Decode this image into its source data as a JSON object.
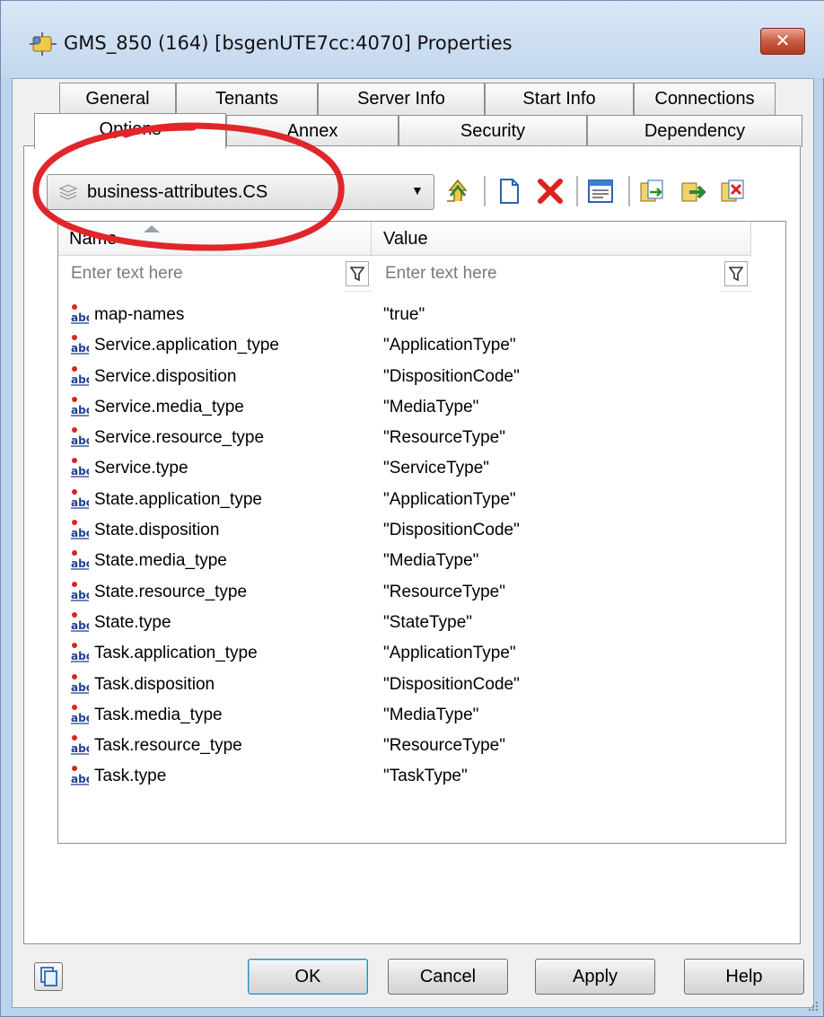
{
  "window": {
    "title": "GMS_850 (164) [bsgenUTE7cc:4070] Properties",
    "close_label": "✕"
  },
  "tabs_back": [
    "General",
    "Tenants",
    "Server Info",
    "Start Info",
    "Connections"
  ],
  "tabs_front": [
    "Options",
    "Annex",
    "Security",
    "Dependency"
  ],
  "active_tab": "Options",
  "section_selector": {
    "selected": "business-attributes.CS"
  },
  "toolbar": {
    "icons": [
      "up-level-icon",
      "new-item-icon",
      "delete-icon",
      "edit-icon",
      "import-icon",
      "export-icon",
      "clear-icon"
    ]
  },
  "grid": {
    "columns": [
      "Name",
      "Value"
    ],
    "filter_placeholders": [
      "Enter text here",
      "Enter text here"
    ],
    "rows": [
      {
        "name": "map-names",
        "value": "\"true\""
      },
      {
        "name": "Service.application_type",
        "value": "\"ApplicationType\""
      },
      {
        "name": "Service.disposition",
        "value": "\"DispositionCode\""
      },
      {
        "name": "Service.media_type",
        "value": "\"MediaType\""
      },
      {
        "name": "Service.resource_type",
        "value": "\"ResourceType\""
      },
      {
        "name": "Service.type",
        "value": "\"ServiceType\""
      },
      {
        "name": "State.application_type",
        "value": "\"ApplicationType\""
      },
      {
        "name": "State.disposition",
        "value": "\"DispositionCode\""
      },
      {
        "name": "State.media_type",
        "value": "\"MediaType\""
      },
      {
        "name": "State.resource_type",
        "value": "\"ResourceType\""
      },
      {
        "name": "State.type",
        "value": "\"StateType\""
      },
      {
        "name": "Task.application_type",
        "value": "\"ApplicationType\""
      },
      {
        "name": "Task.disposition",
        "value": "\"DispositionCode\""
      },
      {
        "name": "Task.media_type",
        "value": "\"MediaType\""
      },
      {
        "name": "Task.resource_type",
        "value": "\"ResourceType\""
      },
      {
        "name": "Task.type",
        "value": "\"TaskType\""
      }
    ]
  },
  "buttons": {
    "ok": "OK",
    "cancel": "Cancel",
    "apply": "Apply",
    "help": "Help"
  },
  "colors": {
    "annotation": "#e0262b",
    "title_bg": "#c3d7ee"
  }
}
